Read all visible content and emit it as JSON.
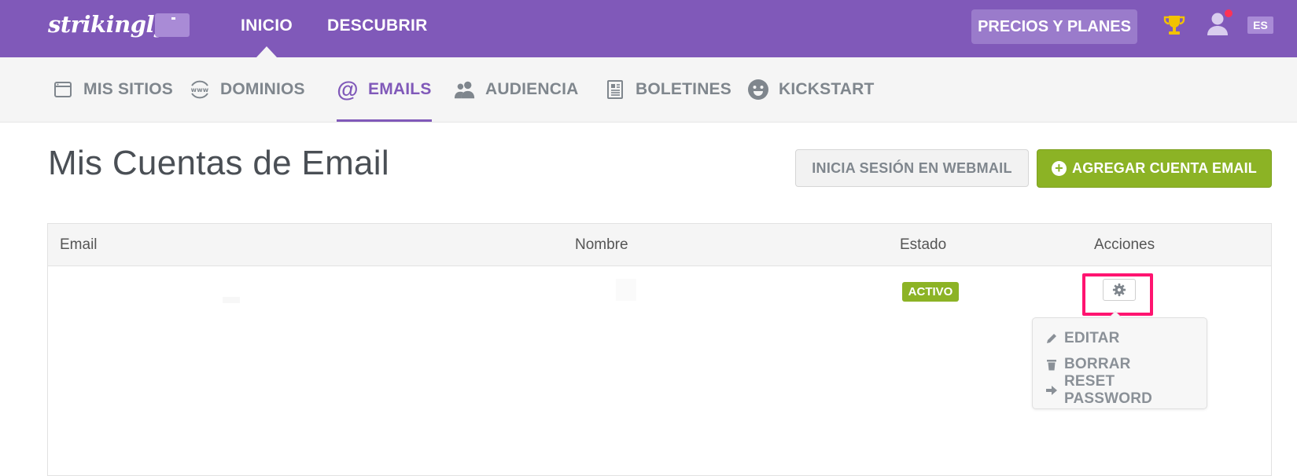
{
  "header": {
    "logo": "strikingly",
    "nav": [
      {
        "label": "INICIO"
      },
      {
        "label": "DESCUBRIR"
      }
    ],
    "pricing_button": "PRECIOS Y PLANES",
    "language": "ES",
    "colors": {
      "brand": "#8059b9",
      "notification": "#ff3355"
    }
  },
  "subnav": {
    "tabs": [
      {
        "label": "MIS SITIOS",
        "icon": "browser-window-icon"
      },
      {
        "label": "DOMINIOS",
        "icon": "www-globe-icon"
      },
      {
        "label": "EMAILS",
        "icon": "at-sign-icon",
        "active": true
      },
      {
        "label": "AUDIENCIA",
        "icon": "users-icon"
      },
      {
        "label": "BOLETINES",
        "icon": "newsletter-icon"
      },
      {
        "label": "KICKSTART",
        "icon": "smiley-icon"
      }
    ]
  },
  "main": {
    "title": "Mis Cuentas de Email",
    "webmail_button": "INICIA SESIÓN EN WEBMAIL",
    "add_button": "AGREGAR CUENTA EMAIL",
    "accent_green": "#8cb325",
    "table": {
      "columns": [
        "Email",
        "Nombre",
        "Estado",
        "Acciones"
      ],
      "rows": [
        {
          "email": "",
          "nombre": "",
          "estado": "ACTIVO"
        }
      ]
    },
    "actions_menu": [
      {
        "label": "EDITAR",
        "icon": "pencil-icon"
      },
      {
        "label": "BORRAR",
        "icon": "trash-icon"
      },
      {
        "label": "RESET PASSWORD",
        "icon": "arrow-right-icon"
      }
    ]
  }
}
